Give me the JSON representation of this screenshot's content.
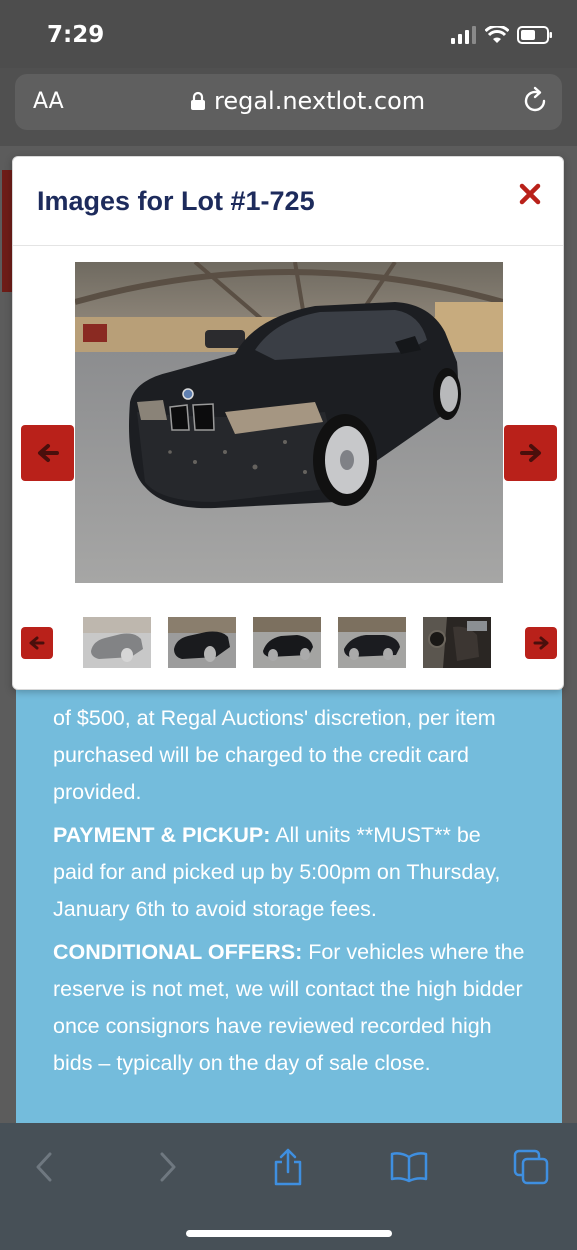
{
  "status": {
    "time": "7:29"
  },
  "browser": {
    "aa_label": "AA",
    "url": "regal.nextlot.com"
  },
  "modal": {
    "title": "Images for Lot #1-725"
  },
  "terms": {
    "intro_fragment": "of $500, at Regal Auctions' discretion, per item purchased will be charged to the credit card provided.",
    "payment_heading": "PAYMENT & PICKUP:",
    "payment_text": " All units **MUST** be paid for and picked up by 5:00pm on Thursday, January 6th to avoid storage fees.",
    "conditional_heading": "CONDITIONAL OFFERS:",
    "conditional_text": " For vehicles where the reserve is not met, we will contact the high bidder once consignors have reviewed recorded high bids – typically on the day of sale close."
  },
  "colors": {
    "accent_red": "#b9211a",
    "title_navy": "#1d2b5c",
    "info_blue": "#74bcdc",
    "toolbar_icon": "#3f8fe0"
  },
  "icons": [
    "lock-icon",
    "reload-icon",
    "close-icon",
    "arrow-left-icon",
    "arrow-right-icon",
    "share-icon",
    "bookmarks-icon",
    "tabs-icon"
  ]
}
